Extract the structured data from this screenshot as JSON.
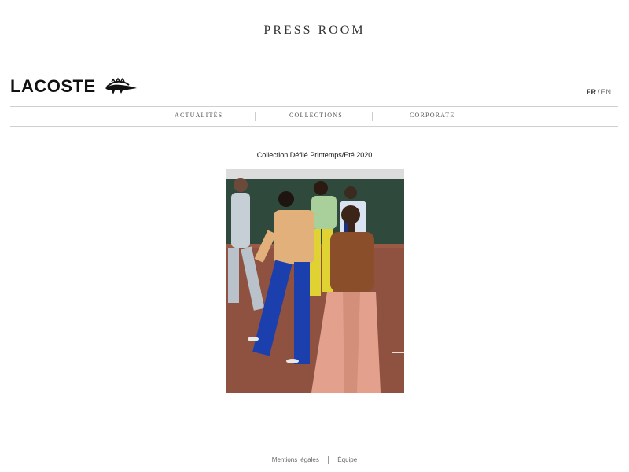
{
  "header": {
    "press_title": "PRESS ROOM",
    "logo_text": "LACOSTE"
  },
  "language": {
    "fr": "FR",
    "separator": "/",
    "en": "EN",
    "active": "fr"
  },
  "nav": {
    "items": [
      {
        "label": "Actualités"
      },
      {
        "label": "Collections"
      },
      {
        "label": "Corporate"
      }
    ]
  },
  "main": {
    "caption": "Collection Défilé Printemps/Eté 2020",
    "image": "runway-photo"
  },
  "footer": {
    "links": [
      {
        "label": "Mentions légales"
      },
      {
        "label": "Équipe"
      }
    ]
  },
  "colors": {
    "background": "#ffffff",
    "divider": "#cfcfcf",
    "text": "#222222"
  }
}
